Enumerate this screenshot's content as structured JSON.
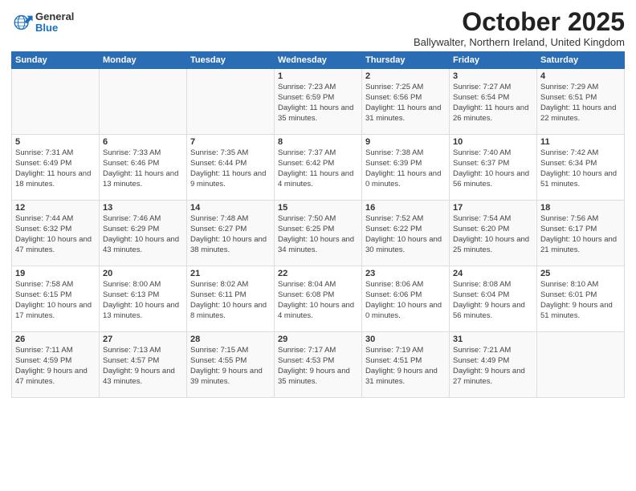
{
  "header": {
    "logo_general": "General",
    "logo_blue": "Blue",
    "month_title": "October 2025",
    "location": "Ballywalter, Northern Ireland, United Kingdom"
  },
  "weekdays": [
    "Sunday",
    "Monday",
    "Tuesday",
    "Wednesday",
    "Thursday",
    "Friday",
    "Saturday"
  ],
  "weeks": [
    [
      {
        "day": "",
        "info": ""
      },
      {
        "day": "",
        "info": ""
      },
      {
        "day": "",
        "info": ""
      },
      {
        "day": "1",
        "info": "Sunrise: 7:23 AM\nSunset: 6:59 PM\nDaylight: 11 hours and 35 minutes."
      },
      {
        "day": "2",
        "info": "Sunrise: 7:25 AM\nSunset: 6:56 PM\nDaylight: 11 hours and 31 minutes."
      },
      {
        "day": "3",
        "info": "Sunrise: 7:27 AM\nSunset: 6:54 PM\nDaylight: 11 hours and 26 minutes."
      },
      {
        "day": "4",
        "info": "Sunrise: 7:29 AM\nSunset: 6:51 PM\nDaylight: 11 hours and 22 minutes."
      }
    ],
    [
      {
        "day": "5",
        "info": "Sunrise: 7:31 AM\nSunset: 6:49 PM\nDaylight: 11 hours and 18 minutes."
      },
      {
        "day": "6",
        "info": "Sunrise: 7:33 AM\nSunset: 6:46 PM\nDaylight: 11 hours and 13 minutes."
      },
      {
        "day": "7",
        "info": "Sunrise: 7:35 AM\nSunset: 6:44 PM\nDaylight: 11 hours and 9 minutes."
      },
      {
        "day": "8",
        "info": "Sunrise: 7:37 AM\nSunset: 6:42 PM\nDaylight: 11 hours and 4 minutes."
      },
      {
        "day": "9",
        "info": "Sunrise: 7:38 AM\nSunset: 6:39 PM\nDaylight: 11 hours and 0 minutes."
      },
      {
        "day": "10",
        "info": "Sunrise: 7:40 AM\nSunset: 6:37 PM\nDaylight: 10 hours and 56 minutes."
      },
      {
        "day": "11",
        "info": "Sunrise: 7:42 AM\nSunset: 6:34 PM\nDaylight: 10 hours and 51 minutes."
      }
    ],
    [
      {
        "day": "12",
        "info": "Sunrise: 7:44 AM\nSunset: 6:32 PM\nDaylight: 10 hours and 47 minutes."
      },
      {
        "day": "13",
        "info": "Sunrise: 7:46 AM\nSunset: 6:29 PM\nDaylight: 10 hours and 43 minutes."
      },
      {
        "day": "14",
        "info": "Sunrise: 7:48 AM\nSunset: 6:27 PM\nDaylight: 10 hours and 38 minutes."
      },
      {
        "day": "15",
        "info": "Sunrise: 7:50 AM\nSunset: 6:25 PM\nDaylight: 10 hours and 34 minutes."
      },
      {
        "day": "16",
        "info": "Sunrise: 7:52 AM\nSunset: 6:22 PM\nDaylight: 10 hours and 30 minutes."
      },
      {
        "day": "17",
        "info": "Sunrise: 7:54 AM\nSunset: 6:20 PM\nDaylight: 10 hours and 25 minutes."
      },
      {
        "day": "18",
        "info": "Sunrise: 7:56 AM\nSunset: 6:17 PM\nDaylight: 10 hours and 21 minutes."
      }
    ],
    [
      {
        "day": "19",
        "info": "Sunrise: 7:58 AM\nSunset: 6:15 PM\nDaylight: 10 hours and 17 minutes."
      },
      {
        "day": "20",
        "info": "Sunrise: 8:00 AM\nSunset: 6:13 PM\nDaylight: 10 hours and 13 minutes."
      },
      {
        "day": "21",
        "info": "Sunrise: 8:02 AM\nSunset: 6:11 PM\nDaylight: 10 hours and 8 minutes."
      },
      {
        "day": "22",
        "info": "Sunrise: 8:04 AM\nSunset: 6:08 PM\nDaylight: 10 hours and 4 minutes."
      },
      {
        "day": "23",
        "info": "Sunrise: 8:06 AM\nSunset: 6:06 PM\nDaylight: 10 hours and 0 minutes."
      },
      {
        "day": "24",
        "info": "Sunrise: 8:08 AM\nSunset: 6:04 PM\nDaylight: 9 hours and 56 minutes."
      },
      {
        "day": "25",
        "info": "Sunrise: 8:10 AM\nSunset: 6:01 PM\nDaylight: 9 hours and 51 minutes."
      }
    ],
    [
      {
        "day": "26",
        "info": "Sunrise: 7:11 AM\nSunset: 4:59 PM\nDaylight: 9 hours and 47 minutes."
      },
      {
        "day": "27",
        "info": "Sunrise: 7:13 AM\nSunset: 4:57 PM\nDaylight: 9 hours and 43 minutes."
      },
      {
        "day": "28",
        "info": "Sunrise: 7:15 AM\nSunset: 4:55 PM\nDaylight: 9 hours and 39 minutes."
      },
      {
        "day": "29",
        "info": "Sunrise: 7:17 AM\nSunset: 4:53 PM\nDaylight: 9 hours and 35 minutes."
      },
      {
        "day": "30",
        "info": "Sunrise: 7:19 AM\nSunset: 4:51 PM\nDaylight: 9 hours and 31 minutes."
      },
      {
        "day": "31",
        "info": "Sunrise: 7:21 AM\nSunset: 4:49 PM\nDaylight: 9 hours and 27 minutes."
      },
      {
        "day": "",
        "info": ""
      }
    ]
  ]
}
